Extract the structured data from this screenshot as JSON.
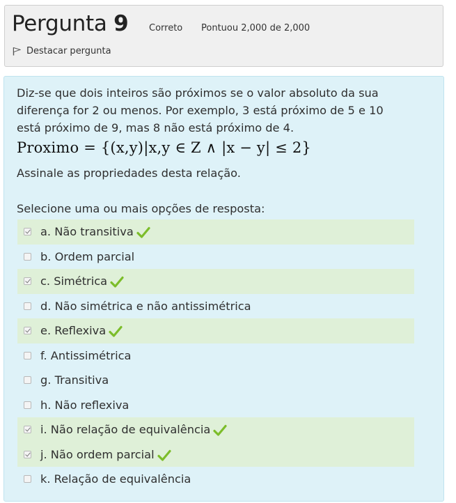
{
  "header": {
    "title_prefix": "Pergunta",
    "title_number": "9",
    "state": "Correto",
    "grade": "Pontuou 2,000 de 2,000",
    "flag_label": "Destacar pergunta",
    "flag_icon": "flag-icon"
  },
  "question": {
    "text": "Diz-se que dois inteiros são próximos se o valor absoluto da sua diferença for 2 ou menos. Por exemplo, 3 está próximo de 5 e 10 está próximo de 9, mas 8 não está próximo de 4.",
    "formula": "Proximo = {(x,y)|x,y ∈ Z ∧ |x − y| ≤ 2}",
    "prompt": "Assinale as propriedades desta relação.",
    "instruction": "Selecione uma ou mais opções de resposta:"
  },
  "colors": {
    "correct_bg": "#dff0d8",
    "content_bg": "#def2f8",
    "info_bg": "#f0f0f0",
    "tick": "#7cbd2a"
  },
  "options": [
    {
      "label": "a. Não transitiva",
      "checked": true,
      "correct": true
    },
    {
      "label": "b. Ordem parcial",
      "checked": false,
      "correct": false
    },
    {
      "label": "c. Simétrica",
      "checked": true,
      "correct": true
    },
    {
      "label": "d. Não simétrica e não antissimétrica",
      "checked": false,
      "correct": false
    },
    {
      "label": "e. Reflexiva",
      "checked": true,
      "correct": true
    },
    {
      "label": "f. Antissimétrica",
      "checked": false,
      "correct": false
    },
    {
      "label": "g. Transitiva",
      "checked": false,
      "correct": false
    },
    {
      "label": "h. Não reflexiva",
      "checked": false,
      "correct": false
    },
    {
      "label": "i. Não relação de equivalência",
      "checked": true,
      "correct": true
    },
    {
      "label": "j. Não ordem parcial",
      "checked": true,
      "correct": true
    },
    {
      "label": "k. Relação de equivalência",
      "checked": false,
      "correct": false
    }
  ]
}
